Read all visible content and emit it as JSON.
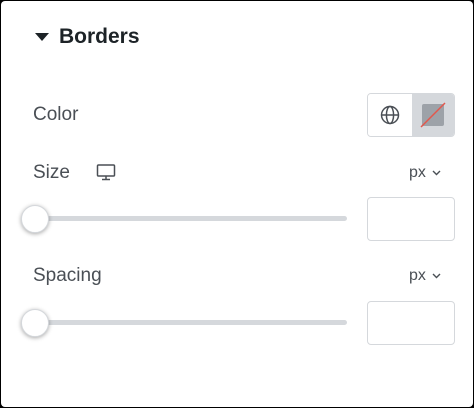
{
  "section": {
    "title": "Borders"
  },
  "color": {
    "label": "Color",
    "global_icon": "globe-icon",
    "swatch_state": "none"
  },
  "size": {
    "label": "Size",
    "device_icon": "desktop-icon",
    "unit": "px",
    "value": "",
    "slider_fraction": 0
  },
  "spacing": {
    "label": "Spacing",
    "unit": "px",
    "value": "",
    "slider_fraction": 0
  },
  "colors": {
    "text_dark": "#1d2327",
    "text_label": "#4a4f55",
    "border": "#d5d8dc",
    "no_color_slash": "#e2574c"
  }
}
